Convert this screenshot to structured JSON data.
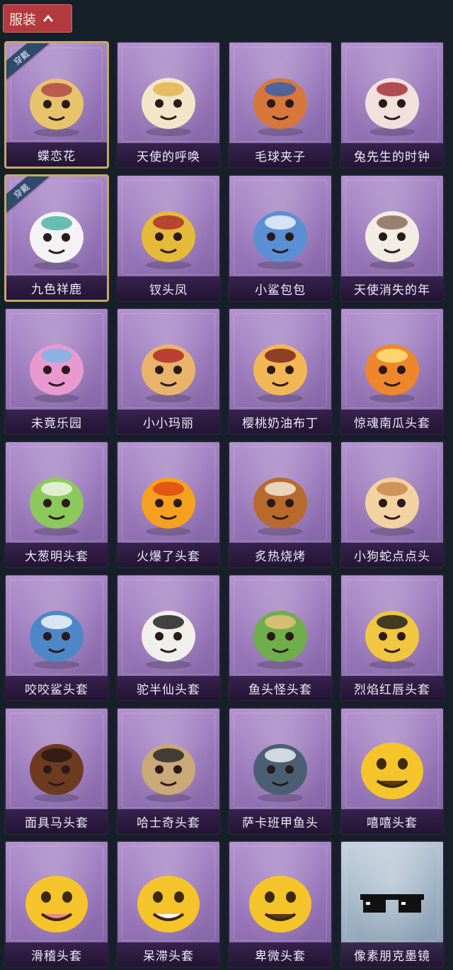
{
  "header": {
    "tab_label": "服装"
  },
  "badge_label": "穿戴",
  "items": [
    {
      "name": "蝶恋花",
      "icon": "butterfly-flower-ornament-icon",
      "worn": true
    },
    {
      "name": "天使的呼唤",
      "icon": "angel-doll-icon",
      "worn": false
    },
    {
      "name": "毛球夹子",
      "icon": "red-panda-drummer-icon",
      "worn": false
    },
    {
      "name": "兔先生的时钟",
      "icon": "rabbit-clock-icon",
      "worn": false
    },
    {
      "name": "九色祥鹿",
      "icon": "deer-ornament-icon",
      "worn": true
    },
    {
      "name": "钗头凤",
      "icon": "phoenix-crown-doll-icon",
      "worn": false
    },
    {
      "name": "小鲨包包",
      "icon": "shark-bag-icon",
      "worn": false
    },
    {
      "name": "天使消失的年",
      "icon": "veiled-angel-doll-icon",
      "worn": false
    },
    {
      "name": "未竟乐园",
      "icon": "pink-hair-doll-icon",
      "worn": false
    },
    {
      "name": "小小玛丽",
      "icon": "little-mary-doll-icon",
      "worn": false
    },
    {
      "name": "樱桃奶油布丁",
      "icon": "cherry-pudding-icon",
      "worn": false
    },
    {
      "name": "惊魂南瓜头套",
      "icon": "pumpkin-head-icon",
      "worn": false
    },
    {
      "name": "大葱明头套",
      "icon": "green-onion-head-icon",
      "worn": false
    },
    {
      "name": "火爆了头套",
      "icon": "fire-head-icon",
      "worn": false
    },
    {
      "name": "炙热烧烤",
      "icon": "bbq-meat-head-icon",
      "worn": false
    },
    {
      "name": "小狗蛇点点头",
      "icon": "snake-head-icon",
      "worn": false
    },
    {
      "name": "咬咬鲨头套",
      "icon": "shark-head-icon",
      "worn": false
    },
    {
      "name": "驼半仙头套",
      "icon": "sunglasses-bear-head-icon",
      "worn": false
    },
    {
      "name": "鱼头怪头套",
      "icon": "fish-head-icon",
      "worn": false
    },
    {
      "name": "烈焰红唇头套",
      "icon": "yellow-red-lips-head-icon",
      "worn": false
    },
    {
      "name": "面具马头套",
      "icon": "horse-head-icon",
      "worn": false
    },
    {
      "name": "哈士奇头套",
      "icon": "husky-head-icon",
      "worn": false
    },
    {
      "name": "萨卡班甲鱼头",
      "icon": "sacabambaspis-head-icon",
      "worn": false
    },
    {
      "name": "嘻嘻头套",
      "icon": "grin-emoji-head-icon",
      "worn": false
    },
    {
      "name": "滑稽头套",
      "icon": "funny-emoji-head-icon",
      "worn": false
    },
    {
      "name": "呆滞头套",
      "icon": "dull-emoji-head-icon",
      "worn": false
    },
    {
      "name": "卑微头套",
      "icon": "humble-emoji-head-icon",
      "worn": false
    },
    {
      "name": "像素朋克墨镜",
      "icon": "pixel-sunglasses-icon",
      "worn": false
    }
  ],
  "colors": {
    "page_bg": "#162029",
    "tab_bg": "#b33a3c",
    "card_purple": "#9a79bb",
    "card_special": "#9fb2c4",
    "worn_border": "#c9a764"
  }
}
